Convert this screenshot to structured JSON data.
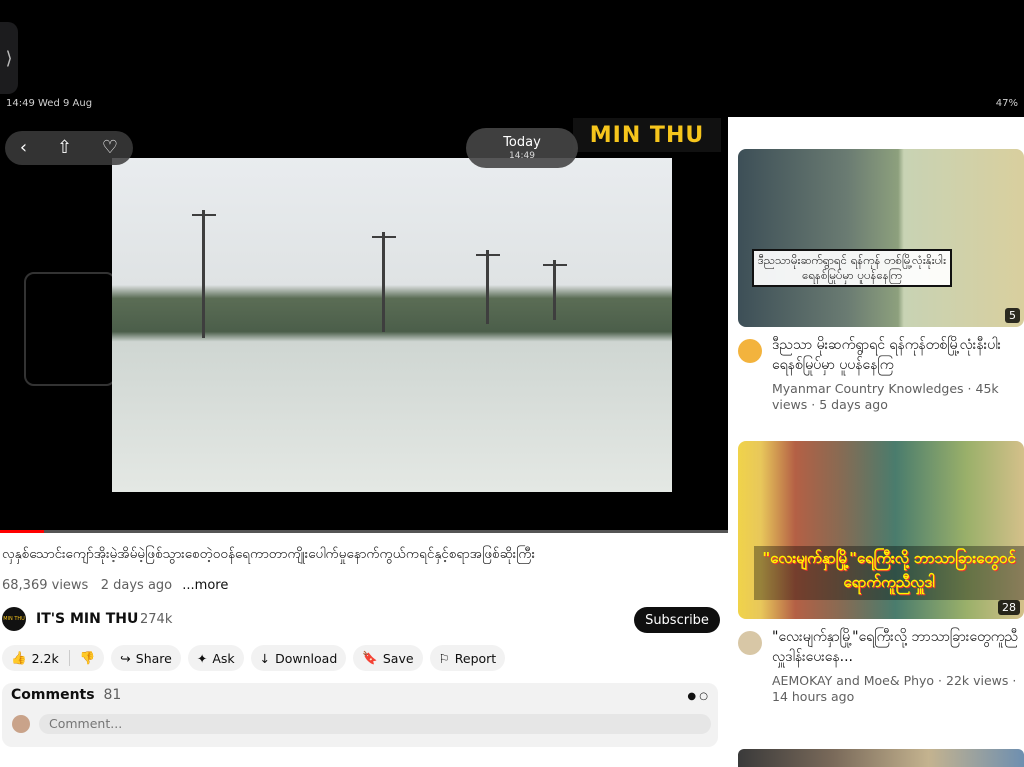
{
  "status_bar": {
    "left": "14:49  Wed 9 Aug",
    "right": "47%"
  },
  "photo_overlay": {
    "today_label": "Today",
    "today_time": "14:49",
    "back_icon": "chevron-left-icon",
    "share_icon": "share-icon",
    "favorite_icon": "heart-icon",
    "adjust_icon": "sliders-icon",
    "info_icon": "info-icon",
    "delete_icon": "trash-icon"
  },
  "player": {
    "watermark": "MIN THU",
    "progress_fraction": 0.06
  },
  "video": {
    "title": "လှနှစ်သောင်းကျော်အိုးမဲ့အိမ်မဲ့ဖြစ်သွားစေတဲ့ဝဝန်ရေကာတာကျိုးပေါက်မှုနောက်ကွယ်ကရင်နှင့်စရာအဖြစ်ဆိုးကြီး",
    "views": "68,369 views",
    "age": "2 days ago",
    "more": "...more"
  },
  "channel": {
    "name": "IT'S MIN THU",
    "subscribers": "274k",
    "subscribe_label": "Subscribe"
  },
  "actions": {
    "likes": "2.2k",
    "share": "Share",
    "ask": "Ask",
    "download": "Download",
    "save": "Save",
    "report": "Report"
  },
  "comments": {
    "label": "Comments",
    "count": "81",
    "placeholder": "Comment..."
  },
  "recommendations": [
    {
      "thumb_caption": "ဒီညသာမိုးဆက်ရွာရင် ရန်ကုန် တစ်မြို့လုံးနိုးပါး ရေနစ်မြုပ်မှာ ပူပန်နေကြ",
      "duration": "5",
      "title": "ဒီညသာ မိုးဆက်ရွာရင် ရန်ကုန်တစ်မြို့လုံးနီးပါး ရေနစ်မြုပ်မှာ ပူပန်နေကြ",
      "channel": "Myanmar Country Knowledges · 45k views · 5 days ago"
    },
    {
      "thumb_caption": "\"လေးမျက်နှာမြို့\"ရေကြီးလို့ ဘာသာခြားတွေဝင်ရောက်ကူညီလှူဒါ",
      "duration": "28",
      "title": "\"လေးမျက်နှာမြို့\"ရေကြီးလို့ ဘာသာခြားတွေကူညီလှူဒါန်းပေးနေ...",
      "channel": "AEMOKAY  and Moe& Phyo · 22k views · 14 hours ago"
    }
  ]
}
